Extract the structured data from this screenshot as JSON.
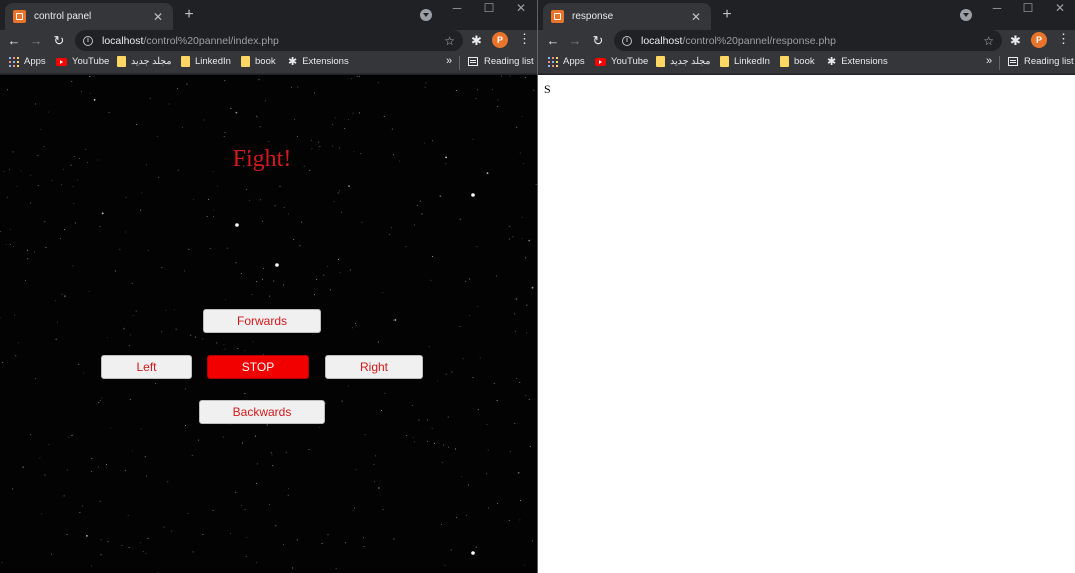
{
  "left_window": {
    "tab": {
      "title": "control panel"
    },
    "address": {
      "host": "localhost",
      "path": "/control%20pannel/index.php"
    },
    "profile_initial": "P",
    "bookmarks": {
      "apps": "Apps",
      "youtube": "YouTube",
      "folder_new": "مجلد جديد",
      "linkedin": "LinkedIn",
      "book": "book",
      "extensions": "Extensions",
      "more": "»",
      "reading_list": "Reading list"
    },
    "page": {
      "heading": "Fight!",
      "buttons": {
        "forwards": "Forwards",
        "left": "Left",
        "stop": "STOP",
        "right": "Right",
        "backwards": "Backwards"
      },
      "colors": {
        "text_red": "#d3191c",
        "stop_bg": "#f20000",
        "background": "#030303"
      }
    }
  },
  "right_window": {
    "tab": {
      "title": "response"
    },
    "address": {
      "host": "localhost",
      "path": "/control%20pannel/response.php"
    },
    "profile_initial": "P",
    "bookmarks": {
      "apps": "Apps",
      "youtube": "YouTube",
      "folder_new": "مجلد جديد",
      "linkedin": "LinkedIn",
      "book": "book",
      "extensions": "Extensions",
      "more": "»",
      "reading_list": "Reading list"
    },
    "page": {
      "response_text": "S"
    }
  },
  "icons": [
    "favicon",
    "close-icon",
    "new-tab-icon",
    "tab-search-icon",
    "minimize-icon",
    "maximize-icon",
    "window-close-icon",
    "back-icon",
    "forward-icon",
    "reload-icon",
    "info-icon",
    "star-icon",
    "extensions-icon",
    "menu-icon",
    "apps-icon",
    "youtube-icon",
    "folder-icon",
    "reading-list-icon"
  ]
}
